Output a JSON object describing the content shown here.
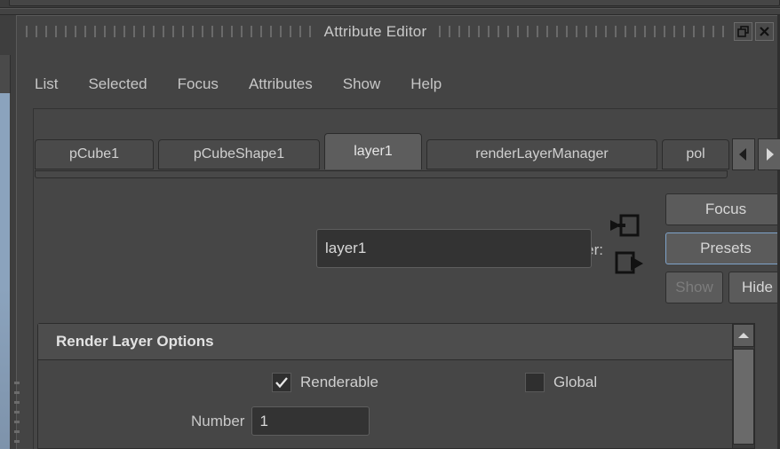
{
  "window": {
    "title": "Attribute Editor",
    "controls": [
      {
        "name": "restore-button",
        "icon": "restore-icon"
      },
      {
        "name": "close-button",
        "icon": "close-icon"
      }
    ]
  },
  "menubar": {
    "items": [
      {
        "label": "List"
      },
      {
        "label": "Selected"
      },
      {
        "label": "Focus"
      },
      {
        "label": "Attributes"
      },
      {
        "label": "Show"
      },
      {
        "label": "Help"
      }
    ]
  },
  "tabs": {
    "items": [
      {
        "label": "pCube1",
        "active": false
      },
      {
        "label": "pCubeShape1",
        "active": false
      },
      {
        "label": "layer1",
        "active": true
      },
      {
        "label": "renderLayerManager",
        "active": false
      },
      {
        "label": "pol",
        "active": false
      }
    ],
    "prev_arrow_icon": "caret-left-icon",
    "next_arrow_icon": "caret-right-icon"
  },
  "node_row": {
    "label": "renderLayer:",
    "value": "layer1",
    "placeholder": "",
    "input_connection_icon": "input-connection-icon",
    "output_connection_icon": "output-connection-icon"
  },
  "buttons": {
    "focus": "Focus",
    "presets": "Presets",
    "show": "Show",
    "hide": "Hide"
  },
  "render_layer_options": {
    "title": "Render Layer Options",
    "renderable": {
      "label": "Renderable",
      "checked": true
    },
    "global": {
      "label": "Global",
      "checked": false
    },
    "number": {
      "label": "Number",
      "value": "1"
    }
  },
  "scrollbar": {
    "up_arrow_icon": "caret-up-icon"
  },
  "colors": {
    "window_bg": "#444444",
    "panel_bg": "#464646",
    "field_bg": "#333333",
    "text": "#c9c9c9",
    "accent_blue": "#7fa3c9",
    "active_tab": "#5d5d5d"
  }
}
